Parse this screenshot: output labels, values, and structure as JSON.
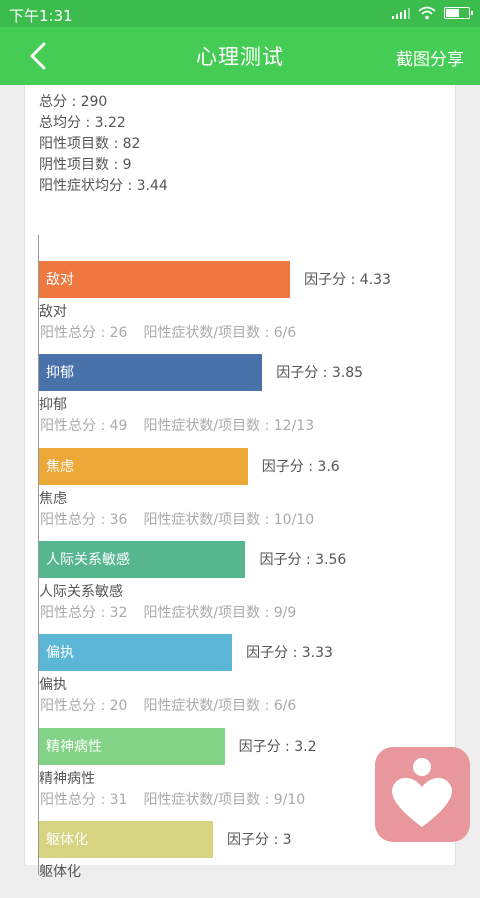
{
  "status": {
    "time": "下午1:31"
  },
  "header": {
    "title": "心理测试",
    "share_label": "截图分享"
  },
  "summary": {
    "total": "总分 : 290",
    "average": "总均分 : 3.22",
    "positive_items": "阳性项目数 : 82",
    "negative_items": "阴性项目数 : 9",
    "positive_avg": "阳性症状均分 : 3.44"
  },
  "factors": [
    {
      "label": "敌对",
      "factor_text": "因子分 : 4.33",
      "factor": 4.33,
      "total_text": "阳性总分 : 26",
      "ratio_text": "阳性症状数/项目数 : 6/6",
      "color": "#ee7840"
    },
    {
      "label": "抑郁",
      "factor_text": "因子分 : 3.85",
      "factor": 3.85,
      "total_text": "阳性总分 : 49",
      "ratio_text": "阳性症状数/项目数 : 12/13",
      "color": "#4a72aa"
    },
    {
      "label": "焦虑",
      "factor_text": "因子分 : 3.6",
      "factor": 3.6,
      "total_text": "阳性总分 : 36",
      "ratio_text": "阳性症状数/项目数 : 10/10",
      "color": "#eda83a"
    },
    {
      "label": "人际关系敏感",
      "factor_text": "因子分 : 3.56",
      "factor": 3.56,
      "total_text": "阳性总分 : 32",
      "ratio_text": "阳性症状数/项目数 : 9/9",
      "color": "#55b690"
    },
    {
      "label": "偏执",
      "factor_text": "因子分 : 3.33",
      "factor": 3.33,
      "total_text": "阳性总分 : 20",
      "ratio_text": "阳性症状数/项目数 : 6/6",
      "color": "#5cb6d6"
    },
    {
      "label": "精神病性",
      "factor_text": "因子分 : 3.2",
      "factor": 3.2,
      "total_text": "阳性总分 : 31",
      "ratio_text": "阳性症状数/项目数 : 9/10",
      "color": "#82d386"
    },
    {
      "label": "躯体化",
      "factor_text": "因子分 : 3",
      "factor": 3,
      "total_text": "",
      "ratio_text": "",
      "color": "#d6d480"
    }
  ]
}
